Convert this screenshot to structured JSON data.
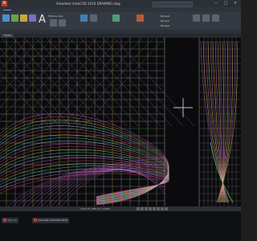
{
  "titlebar": {
    "title": "Autodesk AutoCAD 2016   DRAWING.dwg",
    "search_placeholder": "",
    "window_controls": [
      "—",
      "□",
      "✕"
    ]
  },
  "ribbon": {
    "tabs": [
      "",
      "",
      "",
      "",
      "",
      "",
      "",
      "",
      ""
    ],
    "big_letter": "A",
    "labels": [
      "Explore Links",
      "ByLayer",
      "ByLayer",
      "ByLayer"
    ]
  },
  "viewport": {
    "tab_label": "Model"
  },
  "statusbar": {
    "coords": "1374.75, 886.32, 0.0000"
  },
  "taskbar": {
    "items": [
      {
        "label": "ペイント"
      },
      {
        "label": "Autodesk AutoCAD 2016"
      },
      {
        "label": ""
      }
    ],
    "tray_time": ""
  },
  "colors": {
    "grid_white": "#cfd3d6",
    "grid_yellow": "#e0d64a",
    "grid_green": "#4ec24e",
    "curve_magenta": "#d35fd8",
    "curve_red": "#e05050",
    "curve_cyan": "#4fd0d8",
    "accent_red": "#c8372d"
  }
}
